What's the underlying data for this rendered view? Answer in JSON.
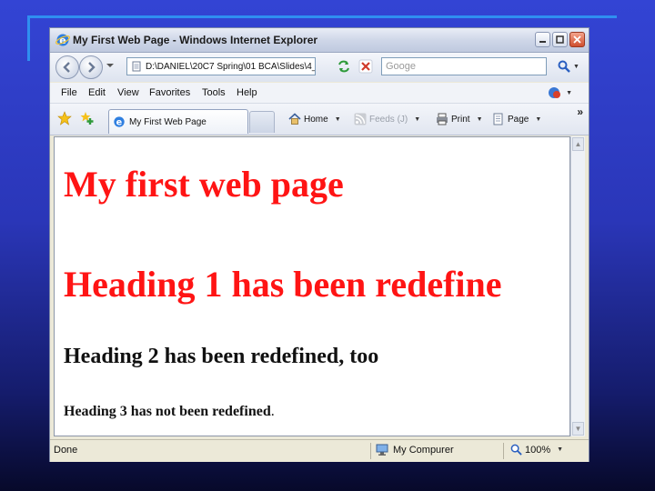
{
  "window": {
    "title": "My First Web Page - Windows Internet Explorer"
  },
  "address": {
    "url": "D:\\DANIEL\\20C7 Spring\\01 BCA\\Slides\\4_",
    "search_placeholder": "Googe"
  },
  "menu": {
    "items": [
      "File",
      "Edit",
      "View",
      "Favorites",
      "Tools",
      "Help"
    ]
  },
  "tab": {
    "label": "My First Web Page"
  },
  "toolbar": {
    "home": "Home",
    "feeds": "Feeds (J)",
    "print": "Print",
    "page": "Page",
    "more": "»"
  },
  "content": {
    "h1_first": "My first web page",
    "h1_second": "Heading 1 has been redefine",
    "h2": "Heading 2 has been redefined, too",
    "h3": "Heading 3 has not been redefined",
    "h3_period": "."
  },
  "status": {
    "text": "Done",
    "zone": "My Compurer",
    "zoom": "100%"
  },
  "colors": {
    "heading1": "#ff1414",
    "heading_dark": "#111111",
    "window_chrome": "#ece9d8",
    "slide_background": "#2a36b8"
  },
  "icons": [
    "ie-logo-icon",
    "back-icon",
    "forward-icon",
    "refresh-icon",
    "stop-icon",
    "search-icon",
    "favorites-star-icon",
    "add-favorites-icon",
    "home-icon",
    "feeds-icon",
    "print-icon",
    "page-icon",
    "computer-icon",
    "zoom-icon",
    "tools-icon"
  ]
}
